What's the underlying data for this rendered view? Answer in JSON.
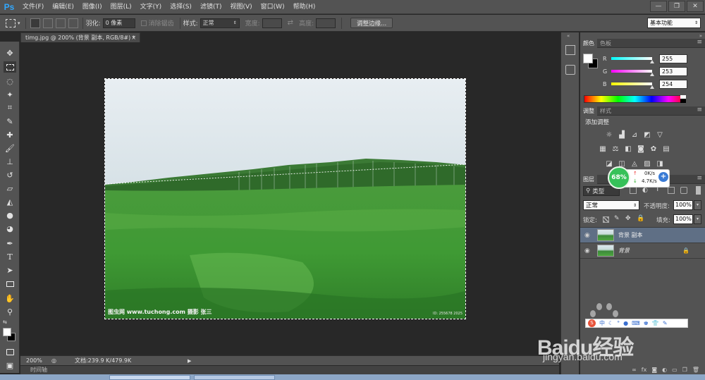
{
  "app": {
    "logo": "Ps"
  },
  "menu": [
    "文件(F)",
    "编辑(E)",
    "图像(I)",
    "图层(L)",
    "文字(Y)",
    "选择(S)",
    "滤镜(T)",
    "视图(V)",
    "窗口(W)",
    "帮助(H)"
  ],
  "window_controls": {
    "minimize": "—",
    "restore": "❐",
    "close": "✕"
  },
  "options": {
    "feather_label": "羽化:",
    "feather_value": "0 像素",
    "antialias_label": "消除锯齿",
    "style_label": "样式:",
    "style_value": "正常",
    "width_label": "宽度:",
    "height_label": "高度:",
    "refine_edge_button": "调整边缘...",
    "workspace": "基本功能"
  },
  "document": {
    "tab_title": "timg.jpg @ 200% (背景 副本, RGB/8#) *",
    "close": "×",
    "watermark_left": "图虫网  www.tuchong.com   摄影 张三",
    "watermark_right": "ID: 255678 2025"
  },
  "status": {
    "zoom": "200%",
    "doc_size": "文档:239.9 K/479.9K"
  },
  "timeline": {
    "label": "时间轴"
  },
  "color_panel": {
    "tabs": [
      "颜色",
      "色板"
    ],
    "channels": [
      {
        "name": "R",
        "value": "255",
        "level": 1.0,
        "color_from": "#00ffff",
        "color_to": "#ffffff"
      },
      {
        "name": "G",
        "value": "253",
        "level": 0.992,
        "color_from": "#ff00ff",
        "color_to": "#ffffff"
      },
      {
        "name": "B",
        "value": "254",
        "level": 0.996,
        "color_from": "#ffff00",
        "color_to": "#ffffff"
      }
    ]
  },
  "adjust_panel": {
    "tabs": [
      "调整",
      "样式"
    ],
    "title": "添加调整"
  },
  "network_widget": {
    "percent": "68%",
    "up": "0K/s",
    "down": "4.7K/s"
  },
  "layers_panel": {
    "tabs": [
      "图层"
    ],
    "filter_label": "类型",
    "blend_mode": "正常",
    "opacity_label": "不透明度:",
    "opacity_value": "100%",
    "lock_label": "锁定:",
    "fill_label": "填充:",
    "fill_value": "100%",
    "layers": [
      {
        "name": "背景 副本",
        "selected": true,
        "locked": false
      },
      {
        "name": "背景",
        "selected": false,
        "locked": true
      }
    ]
  },
  "watermark_brand": {
    "name": "Baidu经验",
    "url": "jingyan.baidu.com"
  }
}
